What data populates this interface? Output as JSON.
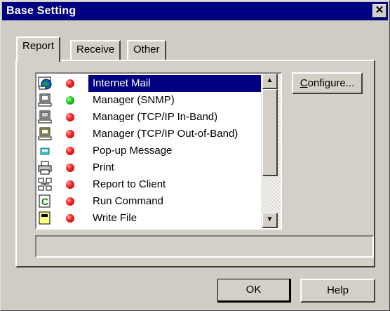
{
  "window": {
    "title": "Base Setting",
    "close_glyph": "✕"
  },
  "tabs": [
    {
      "label": "Report",
      "active": true
    },
    {
      "label": "Receive",
      "active": false
    },
    {
      "label": "Other",
      "active": false
    }
  ],
  "report_list": {
    "items": [
      {
        "label": "Internet Mail",
        "icon": "internet-mail-icon",
        "status": "red",
        "selected": true
      },
      {
        "label": "Manager (SNMP)",
        "icon": "computer-icon",
        "status": "green"
      },
      {
        "label": "Manager (TCP/IP In-Band)",
        "icon": "computer-icon",
        "status": "red"
      },
      {
        "label": "Manager (TCP/IP Out-of-Band)",
        "icon": "computer-icon",
        "status": "red"
      },
      {
        "label": "Pop-up Message",
        "icon": "message-icon",
        "status": "red"
      },
      {
        "label": "Print",
        "icon": "printer-icon",
        "status": "red"
      },
      {
        "label": "Report to Client",
        "icon": "network-icon",
        "status": "red"
      },
      {
        "label": "Run Command",
        "icon": "command-icon",
        "status": "red"
      },
      {
        "label": "Write File",
        "icon": "file-icon",
        "status": "red"
      }
    ]
  },
  "buttons": {
    "configure_prefix": "C",
    "configure_rest": "onfigure...",
    "ok": "OK",
    "help": "Help"
  },
  "status_text": "",
  "colors": {
    "title_bar": "#000080",
    "selection": "#000080",
    "dialog": "#d4d0c8"
  }
}
